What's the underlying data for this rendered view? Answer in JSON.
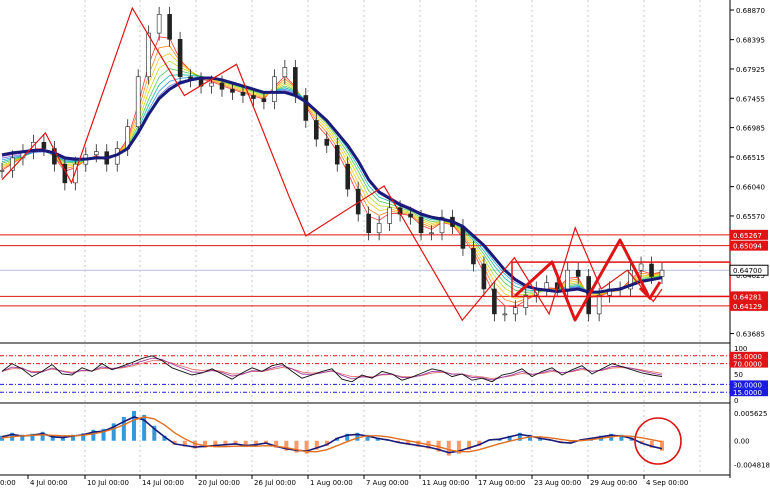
{
  "chart_data": {
    "type": "line",
    "main": {
      "ylim": [
        0.6355,
        0.6895
      ],
      "y_ticks": [
        "0.68870",
        "0.68395",
        "0.67925",
        "0.67455",
        "0.66985",
        "0.66515",
        "0.66040",
        "0.65570",
        "0.65095",
        "0.64625",
        "0.64155",
        "0.63685"
      ],
      "levels": [
        {
          "value": 0.65267,
          "label": "0.65267"
        },
        {
          "value": 0.65094,
          "label": "0.65094"
        },
        {
          "value": 0.64281,
          "label": "0.64281"
        },
        {
          "value": 0.64129,
          "label": "0.64129"
        }
      ],
      "current_price": {
        "value": 0.647,
        "label": "0.64700"
      },
      "close": [
        0.663,
        0.665,
        0.666,
        0.6675,
        0.6665,
        0.664,
        0.661,
        0.664,
        0.6655,
        0.666,
        0.664,
        0.6665,
        0.67,
        0.678,
        0.685,
        0.688,
        0.684,
        0.678,
        0.6775,
        0.6765,
        0.677,
        0.676,
        0.6755,
        0.675,
        0.6745,
        0.674,
        0.678,
        0.6795,
        0.675,
        0.671,
        0.668,
        0.667,
        0.664,
        0.66,
        0.656,
        0.653,
        0.6545,
        0.657,
        0.656,
        0.6555,
        0.653,
        0.653,
        0.6555,
        0.654,
        0.6505,
        0.648,
        0.644,
        0.64,
        0.64,
        0.641,
        0.643,
        0.644,
        0.645,
        0.644,
        0.647,
        0.646,
        0.64,
        0.643,
        0.644,
        0.644,
        0.647,
        0.648,
        0.646,
        0.647
      ],
      "ema_slow": [
        0.6655,
        0.6658,
        0.666,
        0.6662,
        0.6662,
        0.6658,
        0.665,
        0.6648,
        0.6648,
        0.665,
        0.665,
        0.6655,
        0.6665,
        0.669,
        0.672,
        0.6745,
        0.676,
        0.677,
        0.6775,
        0.6778,
        0.6778,
        0.6775,
        0.677,
        0.6765,
        0.676,
        0.6755,
        0.6755,
        0.6755,
        0.675,
        0.674,
        0.6725,
        0.671,
        0.669,
        0.667,
        0.6645,
        0.6615,
        0.6595,
        0.6585,
        0.6575,
        0.6568,
        0.656,
        0.6555,
        0.6552,
        0.6548,
        0.654,
        0.6525,
        0.651,
        0.649,
        0.647,
        0.6455,
        0.6445,
        0.644,
        0.6438,
        0.6436,
        0.6438,
        0.644,
        0.6435,
        0.6435,
        0.6438,
        0.644,
        0.6446,
        0.6452,
        0.6455,
        0.6458
      ],
      "zigzag": [
        [
          0,
          0.6615
        ],
        [
          5,
          0.669
        ],
        [
          8,
          0.661
        ],
        [
          15,
          0.689
        ],
        [
          21,
          0.675
        ],
        [
          27,
          0.68
        ],
        [
          33,
          0.659
        ],
        [
          35,
          0.6525
        ],
        [
          44,
          0.6605
        ],
        [
          53,
          0.639
        ],
        [
          59,
          0.649
        ],
        [
          63,
          0.64
        ],
        [
          66,
          0.6538
        ],
        [
          69,
          0.644
        ],
        [
          72,
          0.647
        ],
        [
          75,
          0.642
        ],
        [
          76,
          0.644
        ]
      ],
      "box": {
        "top": 0.6475,
        "bottom": 0.6452
      }
    },
    "rsi": {
      "ylim": [
        0,
        100
      ],
      "levels": [
        {
          "value": 85,
          "label": "85.0000"
        },
        {
          "value": 70,
          "label": "70.0000"
        },
        {
          "value": 30,
          "label": "30.0000"
        },
        {
          "value": 15,
          "label": "15.0000"
        }
      ],
      "ticks": [
        "100",
        "50",
        "0"
      ],
      "line": [
        55,
        70,
        60,
        45,
        55,
        68,
        50,
        48,
        62,
        55,
        70,
        58,
        65,
        72,
        80,
        85,
        76,
        62,
        55,
        48,
        52,
        60,
        50,
        40,
        52,
        62,
        55,
        66,
        70,
        55,
        42,
        48,
        55,
        60,
        40,
        35,
        48,
        42,
        55,
        50,
        38,
        44,
        52,
        60,
        56,
        45,
        50,
        38,
        42,
        35,
        48,
        52,
        60,
        45,
        55,
        62,
        48,
        58,
        66,
        50,
        60,
        70,
        64,
        58,
        52,
        48,
        45
      ]
    },
    "macd": {
      "ticks": [
        "0.005625",
        "0.00",
        "-0.004818"
      ],
      "ylim": [
        -0.0065,
        0.007
      ],
      "histogram": [
        0.001,
        0.0016,
        0.0012,
        0.0014,
        0.0018,
        0.001,
        0.0008,
        0.0012,
        0.0015,
        0.0022,
        0.0024,
        0.0035,
        0.0048,
        0.006,
        0.0052,
        0.003,
        0.001,
        -0.0008,
        -0.0012,
        -0.0016,
        -0.0014,
        -0.0012,
        -0.001,
        -0.0008,
        -0.0012,
        -0.001,
        -0.0006,
        -0.0014,
        -0.002,
        -0.0024,
        -0.0026,
        -0.0018,
        -0.001,
        0.0006,
        0.0014,
        0.0016,
        0.0012,
        0.0006,
        0.0002,
        -0.0004,
        -0.0008,
        -0.0012,
        -0.0016,
        -0.0022,
        -0.003,
        -0.0026,
        -0.0018,
        -0.001,
        0.0002,
        0.0004,
        0.001,
        0.0016,
        0.0012,
        0.0006,
        0.0002,
        -0.0004,
        -0.0006,
        0.0002,
        0.0006,
        0.001,
        0.0014,
        0.0012,
        0.0006,
        -0.0006,
        -0.0014,
        -0.002
      ],
      "signal": [
        0.0006,
        0.0008,
        0.001,
        0.0011,
        0.0012,
        0.0011,
        0.001,
        0.001,
        0.0011,
        0.0014,
        0.0018,
        0.0024,
        0.0032,
        0.0042,
        0.0048,
        0.0044,
        0.0032,
        0.0016,
        0.0004,
        -0.0006,
        -0.001,
        -0.0012,
        -0.0012,
        -0.0011,
        -0.0011,
        -0.0011,
        -0.001,
        -0.0011,
        -0.0014,
        -0.0018,
        -0.0022,
        -0.0022,
        -0.0018,
        -0.001,
        -0.0002,
        0.0006,
        0.001,
        0.001,
        0.0008,
        0.0004,
        0.0,
        -0.0004,
        -0.0008,
        -0.0012,
        -0.0018,
        -0.0022,
        -0.0022,
        -0.0018,
        -0.0012,
        -0.0006,
        -0.0001,
        0.0004,
        0.0008,
        0.0008,
        0.0006,
        0.0003,
        0.0,
        0.0,
        0.0002,
        0.0005,
        0.0008,
        0.001,
        0.0009,
        0.0006,
        0.0002,
        -0.0002
      ]
    },
    "x_labels": [
      "4 Jul 00:00",
      "10 Jul 00:00",
      "14 Jul 00:00",
      "20 Jul 00:00",
      "26 Jul 00:00",
      "1 Aug 00:00",
      "7 Aug 00:00",
      "11 Aug 00:00",
      "17 Aug 00:00",
      "23 Aug 00:00",
      "29 Aug 00:00",
      "4 Sep 00:00"
    ],
    "x_label_cut": "0:00"
  },
  "colors": {
    "ema_slow": "#1a1a7a",
    "zigzag": "#e01414",
    "level": "#e01414",
    "current_price_box": "#e01414",
    "rsi_line": "#111111",
    "rsi_ma": "#a040a0",
    "rsi_ma2": "#e07070",
    "hist_up": "#3399dd",
    "hist_down": "#ff9966",
    "macd_signal": "#e07020",
    "macd_line": "#1a1a7a",
    "grid": "#c8c8c8"
  }
}
